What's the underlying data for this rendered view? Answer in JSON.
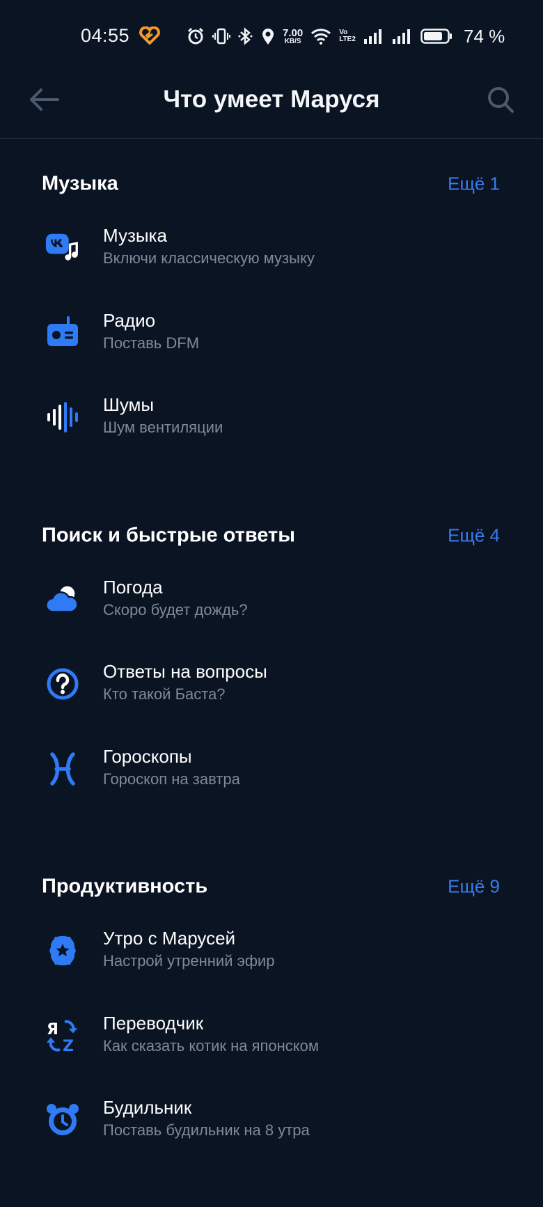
{
  "status_bar": {
    "time": "04:55",
    "speed_value": "7.00",
    "speed_unit": "KB/S",
    "volte_top": "Vo",
    "volte_bottom": "LTE2",
    "battery_percent": "74 %"
  },
  "app_bar": {
    "title": "Что умеет Маруся"
  },
  "sections": [
    {
      "title": "Музыка",
      "more": "Ещё 1",
      "items": [
        {
          "title": "Музыка",
          "subtitle": "Включи классическую музыку",
          "icon": "vk-music-icon"
        },
        {
          "title": "Радио",
          "subtitle": "Поставь DFM",
          "icon": "radio-icon"
        },
        {
          "title": "Шумы",
          "subtitle": "Шум вентиляции",
          "icon": "soundwave-icon"
        }
      ]
    },
    {
      "title": "Поиск и быстрые ответы",
      "more": "Ещё 4",
      "items": [
        {
          "title": "Погода",
          "subtitle": "Скоро будет дождь?",
          "icon": "weather-icon"
        },
        {
          "title": "Ответы на вопросы",
          "subtitle": "Кто такой Баста?",
          "icon": "question-icon"
        },
        {
          "title": "Гороскопы",
          "subtitle": "Гороскоп на завтра",
          "icon": "pisces-icon"
        }
      ]
    },
    {
      "title": "Продуктивность",
      "more": "Ещё 9",
      "items": [
        {
          "title": "Утро с Марусей",
          "subtitle": "Настрой утренний эфир",
          "icon": "morning-star-icon"
        },
        {
          "title": "Переводчик",
          "subtitle": "Как сказать котик на японском",
          "icon": "translate-icon"
        },
        {
          "title": "Будильник",
          "subtitle": "Поставь будильник на 8 утра",
          "icon": "alarm-clock-icon"
        }
      ]
    }
  ],
  "colors": {
    "background": "#0b1422",
    "accent": "#2f7af5",
    "link": "#3a7bf0",
    "subtitle": "#7e8a9c"
  }
}
